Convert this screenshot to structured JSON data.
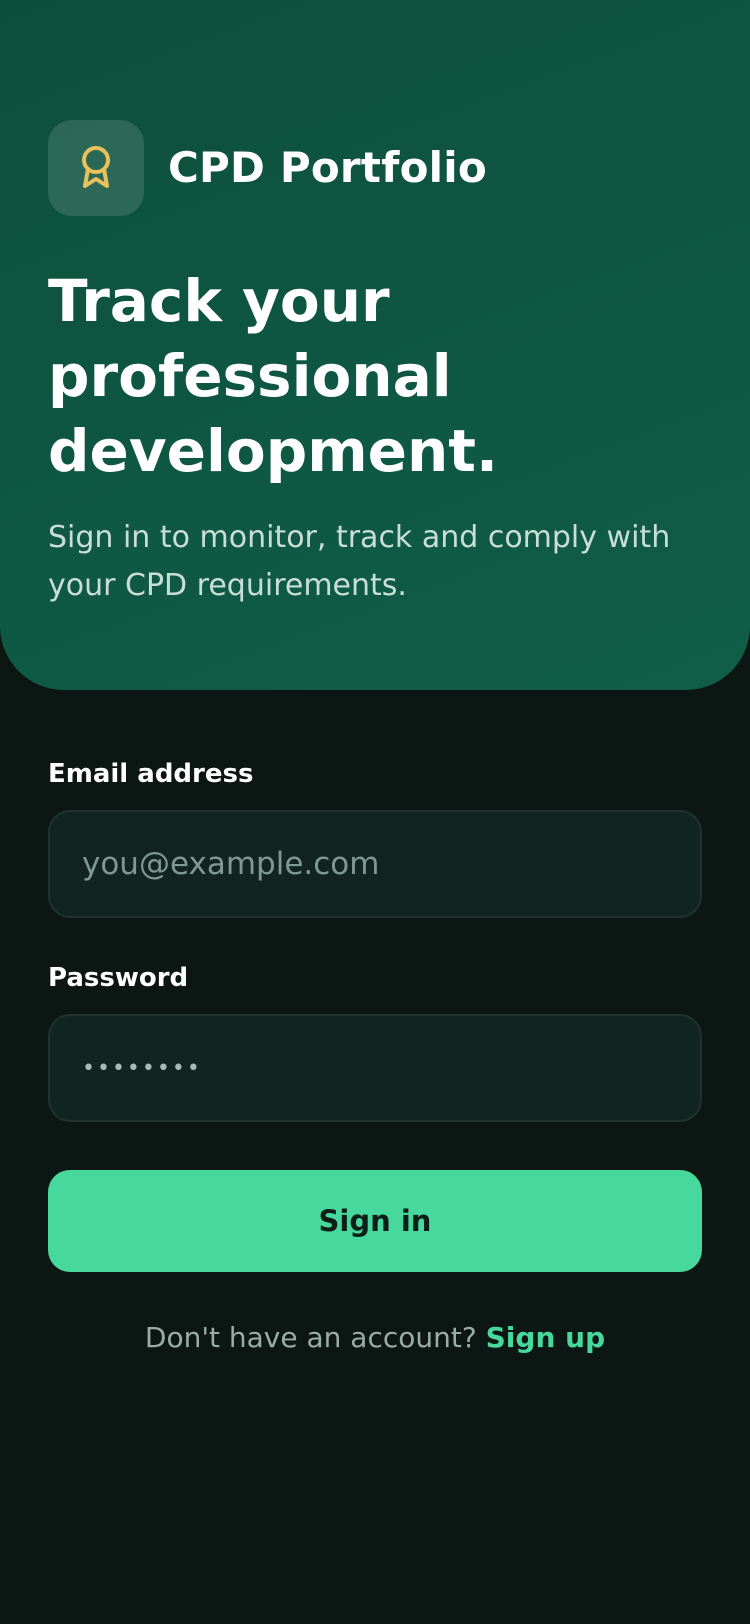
{
  "brand": {
    "name": "CPD Portfolio",
    "icon": "award-ribbon-icon"
  },
  "hero": {
    "headline": "Track your professional development.",
    "subtitle": "Sign in to monitor, track and comply with your CPD requirements."
  },
  "form": {
    "email_label": "Email address",
    "email_placeholder": "you@example.com",
    "password_label": "Password",
    "password_placeholder": "••••••••",
    "submit_label": "Sign in"
  },
  "footer": {
    "prompt": "Don't have an account?",
    "signup_label": "Sign up"
  },
  "colors": {
    "hero_background": "#0f5a44",
    "page_background": "#0c1613",
    "accent": "#46d89c",
    "icon_gold": "#e9c15a"
  }
}
